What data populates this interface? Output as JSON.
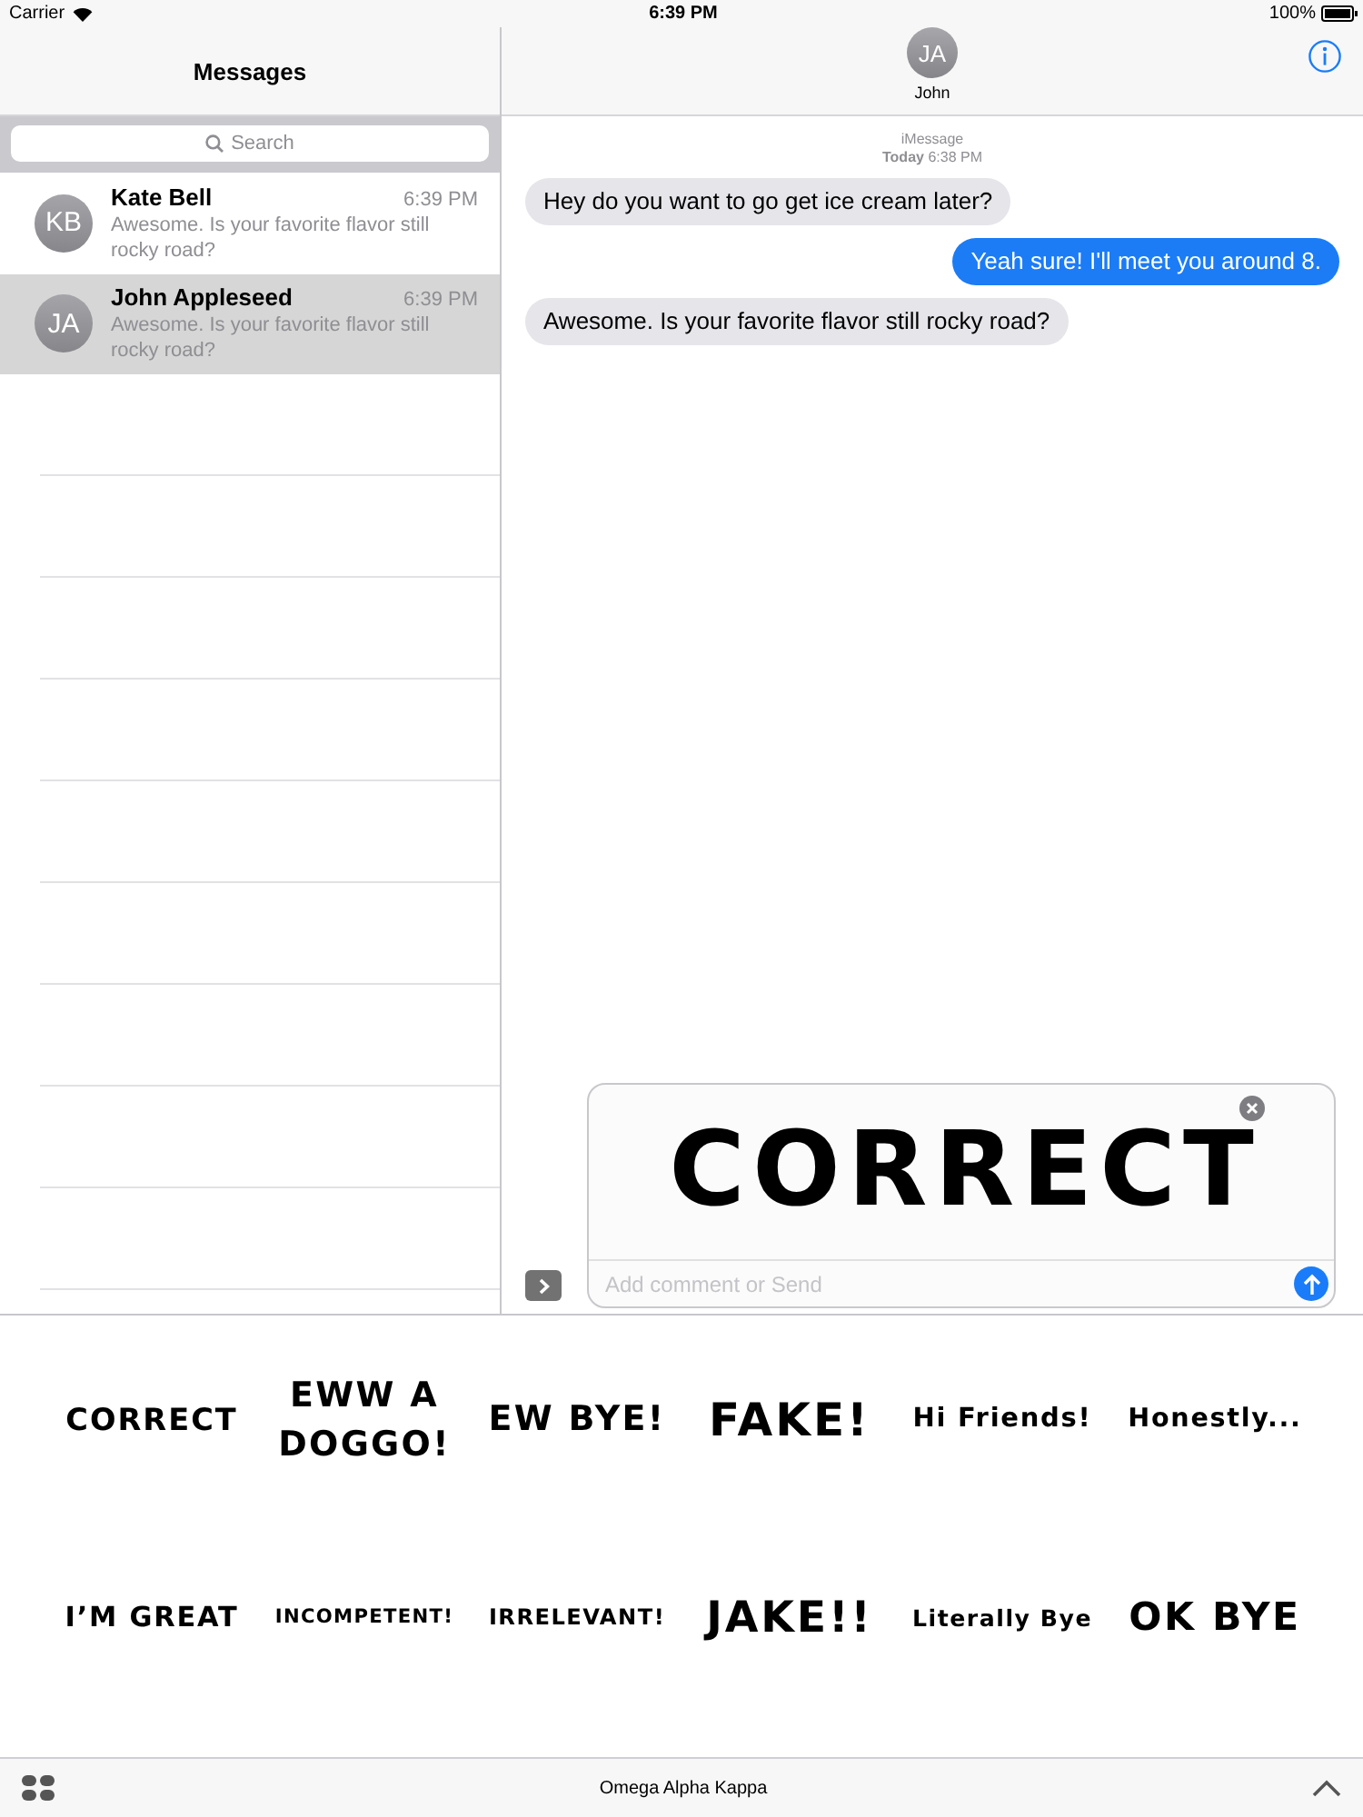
{
  "status_bar": {
    "carrier": "Carrier",
    "time": "6:39 PM",
    "battery": "100%"
  },
  "sidebar": {
    "title": "Messages",
    "search": {
      "placeholder": "Search"
    },
    "conversations": [
      {
        "initials": "KB",
        "name": "Kate Bell",
        "time": "6:39 PM",
        "preview": "Awesome. Is your favorite flavor still rocky road?",
        "selected": false
      },
      {
        "initials": "JA",
        "name": "John Appleseed",
        "time": "6:39 PM",
        "preview": "Awesome. Is your favorite flavor still rocky road?",
        "selected": true
      }
    ]
  },
  "chat": {
    "contact": {
      "initials": "JA",
      "name": "John"
    },
    "service": "iMessage",
    "timestamp": "**Today** 6:38 PM",
    "messages": [
      {
        "text": "Hey do you want to go get ice cream later?",
        "outgoing": false
      },
      {
        "text": "Yeah sure! I'll meet you around 8.",
        "outgoing": true
      },
      {
        "text": "Awesome. Is your favorite flavor still rocky road?",
        "outgoing": false
      }
    ]
  },
  "composer": {
    "sticker": "CORRECT",
    "placeholder": "Add comment or Send"
  },
  "sticker_drawer": {
    "stickers": [
      "CORRECT",
      "EWW A DOGGO!",
      "EW BYE!",
      "FAKE!",
      "Hi Friends!",
      "Honestly...",
      "I’M GREAT",
      "INCOMPETENT!",
      "IRRELEVANT!",
      "JAKE!!",
      "Literally Bye",
      "OK BYE"
    ]
  },
  "app_bar": {
    "title": "Omega Alpha Kappa"
  }
}
